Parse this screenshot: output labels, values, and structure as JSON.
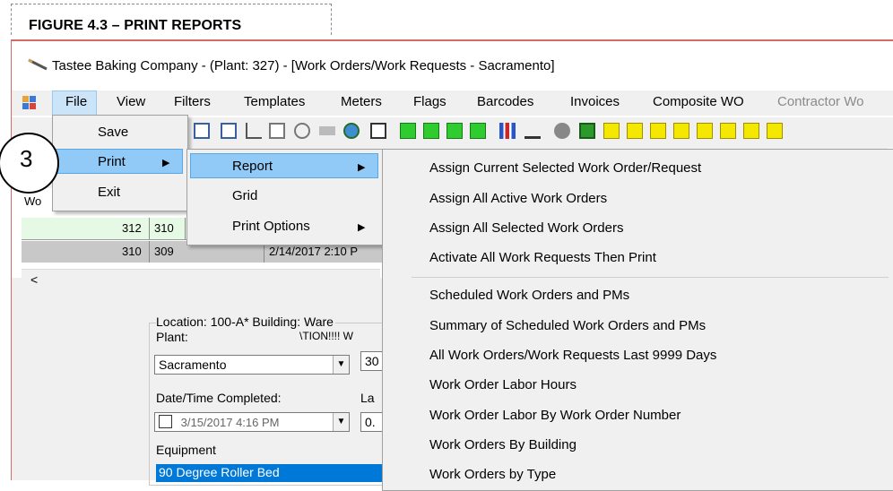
{
  "figure": {
    "caption": "FIGURE 4.3 – PRINT REPORTS"
  },
  "window": {
    "title": "Tastee Baking Company - (Plant: 327) - [Work Orders/Work Requests - Sacramento]"
  },
  "menubar": [
    "File",
    "View",
    "Filters",
    "Templates",
    "Meters",
    "Flags",
    "Barcodes",
    "Invoices",
    "Composite WO",
    "Contractor Wo"
  ],
  "file_menu": {
    "items": [
      "Save",
      "Print",
      "Exit"
    ]
  },
  "print_menu": {
    "items": [
      "Report",
      "Grid",
      "Print Options"
    ]
  },
  "report_menu": {
    "group1": [
      "Assign Current Selected Work Order/Request",
      "Assign All Active Work Orders",
      "Assign All Selected Work Orders",
      "Activate All Work Requests Then Print"
    ],
    "group2": [
      "Scheduled Work Orders and PMs",
      "Summary of Scheduled Work Orders and PMs",
      "All Work Orders/Work Requests Last 9999 Days",
      "Work Order Labor Hours",
      "Work Order Labor By Work Order Number",
      "Work Orders By Building",
      "Work Orders by Type"
    ]
  },
  "callout": {
    "number": "3"
  },
  "grid": {
    "header_stub": "Wo",
    "rows": [
      {
        "c1": "312",
        "c2": "310",
        "c3": ""
      },
      {
        "c1": "310",
        "c2": "309",
        "c3": "2/14/2017 2:10 P"
      }
    ],
    "scroll_left": "<"
  },
  "form": {
    "location": "Location: 100-A* Building: Ware",
    "location_line2": "\\TION!!!! W",
    "plant_label": "Plant:",
    "plant_value": "Sacramento",
    "plant_extra": "30",
    "date_label": "Date/Time Completed:",
    "date_extra_label": "La",
    "date_value": "3/15/2017   4:16 PM",
    "date_extra_value": "0.",
    "equipment_label": "Equipment",
    "equipment_value": "90 Degree Roller Bed"
  },
  "colors": {
    "highlight": "#91c9f7",
    "selection": "#0078d7",
    "window_border": "#d46a6a"
  },
  "toolbar": {
    "icons": [
      "save-icon",
      "money-icon",
      "money-icon",
      "ruler-icon",
      "chart-icon",
      "key-icon",
      "barcode-icon",
      "clock-icon",
      "form-icon",
      "green-doc-icon",
      "green-ruler-icon",
      "green-chart-icon",
      "green-edit-icon",
      "bar-chart-icon",
      "chart-settings-icon",
      "gear-icon",
      "image-icon",
      "yellow-doc-icon",
      "yellow-doc-icon",
      "yellow-chart-icon",
      "yellow-ruler-icon",
      "yellow-money-icon",
      "yellow-doc-icon"
    ]
  }
}
